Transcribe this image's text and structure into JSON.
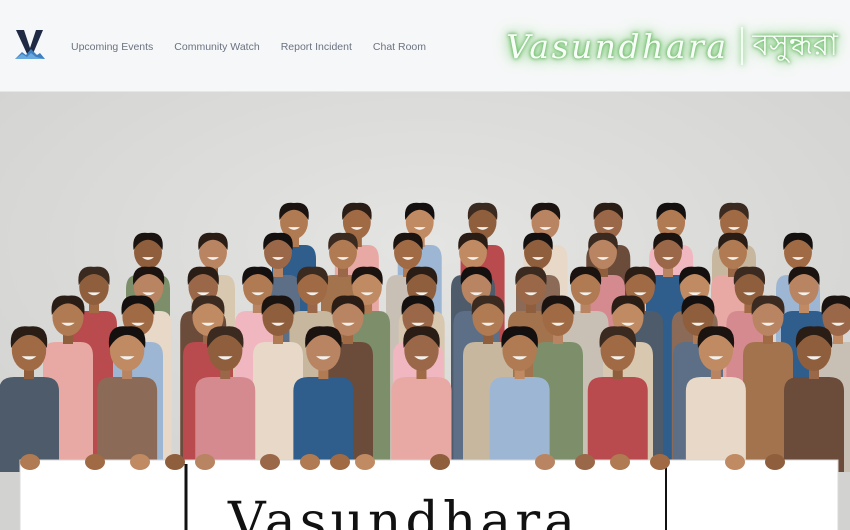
{
  "navbar": {
    "logo_icon": "vasundhara-v-logo-icon",
    "links": [
      {
        "label": "Upcoming Events"
      },
      {
        "label": "Community Watch"
      },
      {
        "label": "Report Incident"
      },
      {
        "label": "Chat Room"
      }
    ],
    "brand": {
      "latin": "Vasundhara",
      "bangla": "বসুন্ধরা",
      "glow_color": "#7ccf77"
    }
  },
  "hero": {
    "image_icon": "group-photo-community-members",
    "banner_text": "Vasundhara"
  },
  "colors": {
    "navbar_bg": "#f6f7f8",
    "nav_link": "#6b7280",
    "hero_bg": "#dcdcda",
    "banner_bg": "#ffffff"
  }
}
